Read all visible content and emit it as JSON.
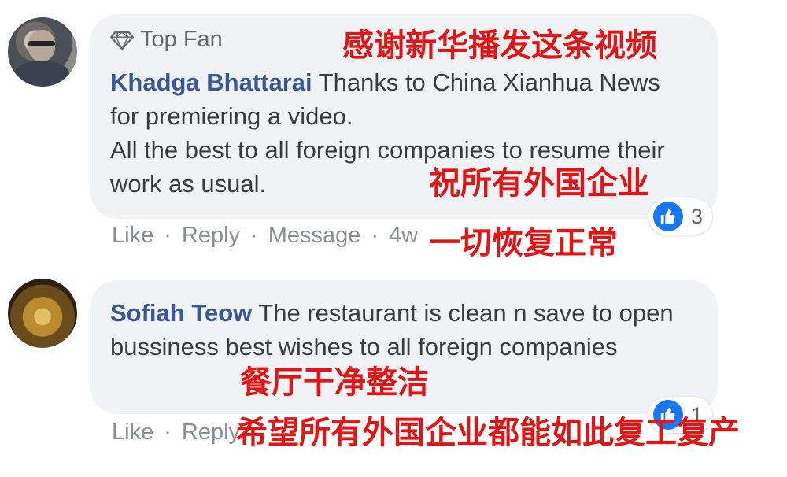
{
  "comments": [
    {
      "badge": "Top Fan",
      "author": "Khadga Bhattarai",
      "text": "Thanks to China Xianhua News for premiering a video.\nAll the best to all foreign companies to resume their work as usual.",
      "reaction_count": "3",
      "actions": {
        "like": "Like",
        "reply": "Reply",
        "message": "Message",
        "time": "4w"
      }
    },
    {
      "author": "Sofiah Teow",
      "text": "The restaurant is clean n save to open bussiness best wishes to all foreign companies",
      "reaction_count": "1",
      "actions": {
        "like": "Like",
        "reply": "Reply"
      }
    }
  ],
  "captions": [
    "感谢新华播发这条视频",
    "祝所有外国企业",
    "一切恢复正常",
    "餐厅干净整洁",
    "希望所有外国企业都能如此复工复产"
  ],
  "colors": {
    "author_link": "#385898",
    "like_blue": "#1877f2",
    "caption_red": "#e01515",
    "bubble_bg": "#f0f2f5"
  },
  "icons": [
    "diamond-icon",
    "like-icon"
  ]
}
